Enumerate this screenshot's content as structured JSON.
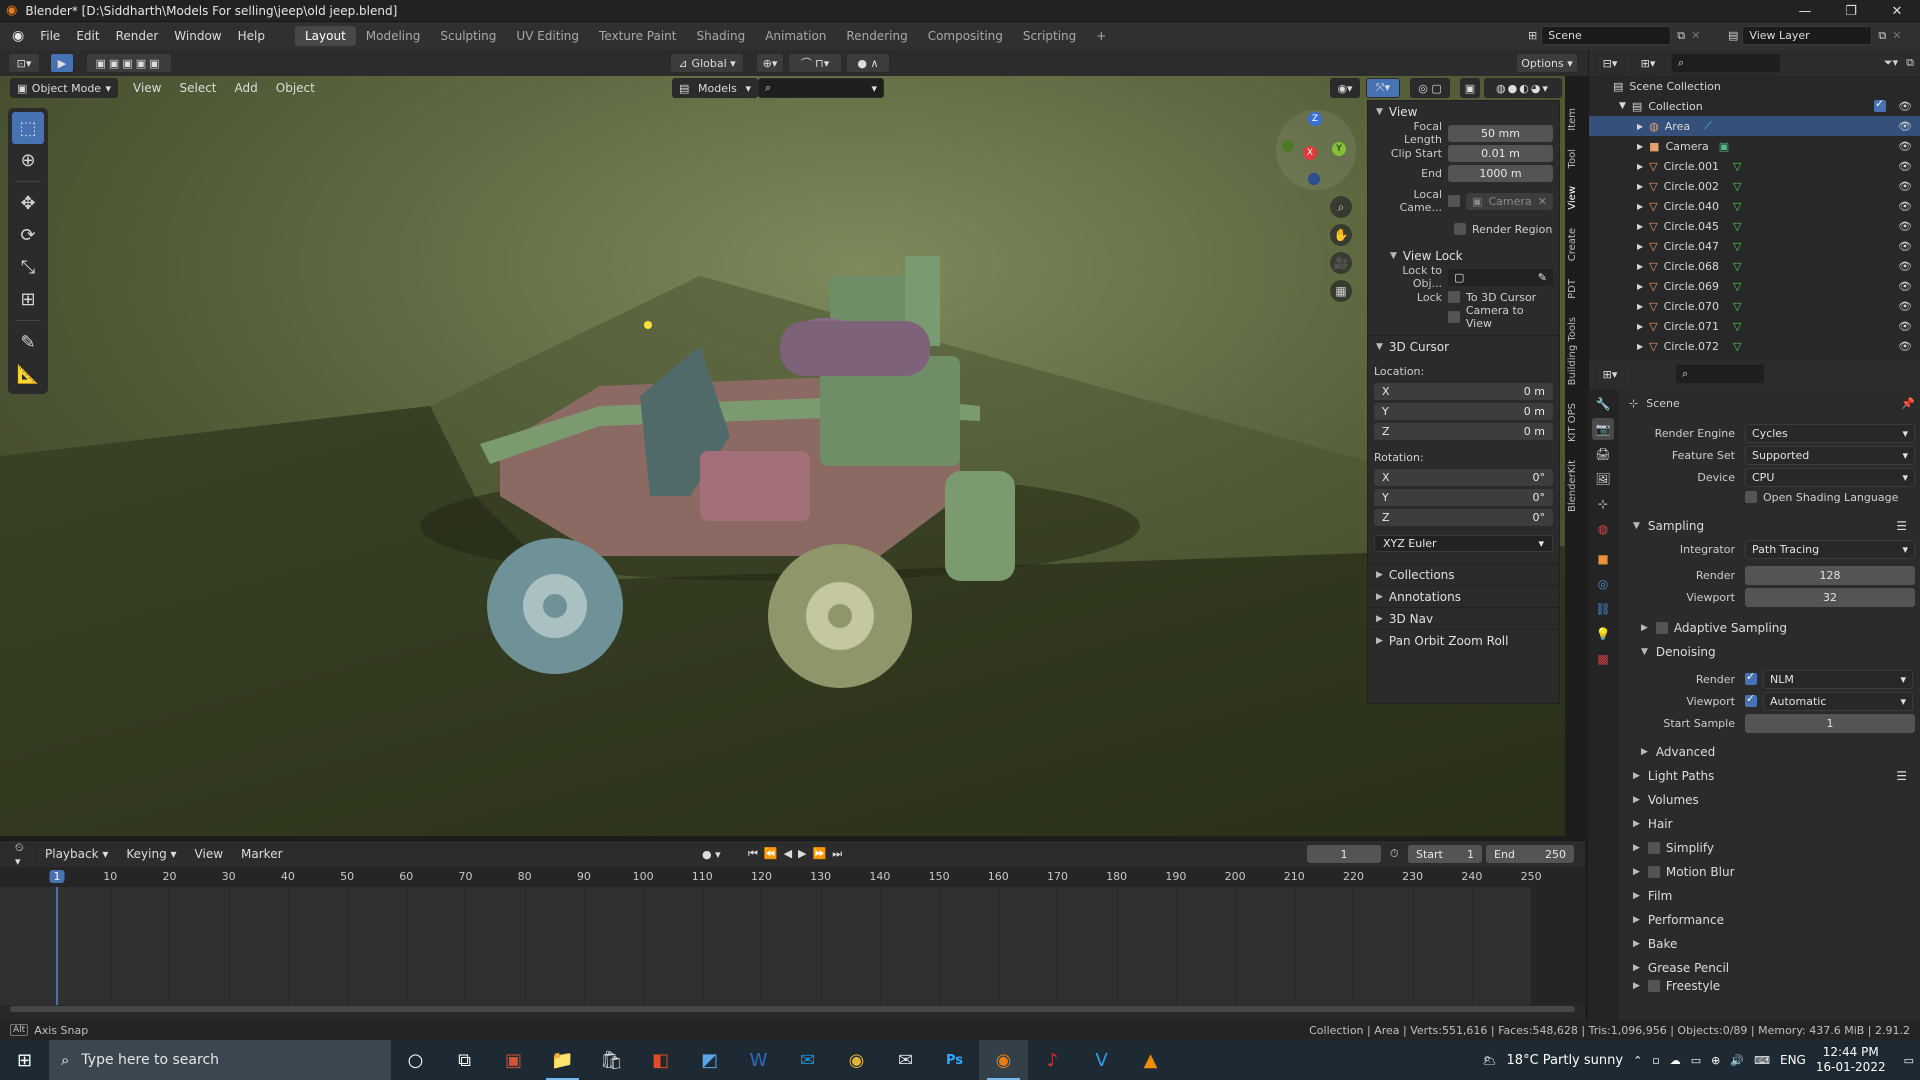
{
  "title": "Blender* [D:\\Siddharth\\Models For selling\\jeep\\old jeep.blend]",
  "menus": [
    "File",
    "Edit",
    "Render",
    "Window",
    "Help"
  ],
  "workspaces": [
    "Layout",
    "Modeling",
    "Sculpting",
    "UV Editing",
    "Texture Paint",
    "Shading",
    "Animation",
    "Rendering",
    "Compositing",
    "Scripting",
    "+"
  ],
  "active_workspace": "Layout",
  "scene_label": "Scene",
  "view_layer_label": "View Layer",
  "header": {
    "transform_orientation": "Global",
    "options": "Options",
    "mode": "Object Mode",
    "view": "View",
    "select": "Select",
    "add": "Add",
    "object": "Object",
    "collection_filter": "Models"
  },
  "npanel": {
    "view_title": "View",
    "focal_length_label": "Focal Length",
    "focal_length": "50 mm",
    "clip_start_label": "Clip Start",
    "clip_start": "0.01 m",
    "end_label": "End",
    "clip_end": "1000 m",
    "local_camera_label": "Local Came...",
    "local_camera": "Camera",
    "render_region": "Render Region",
    "view_lock_title": "View Lock",
    "lock_to_obj_label": "Lock to Obj...",
    "lock_label": "Lock",
    "to_3d_cursor": "To 3D Cursor",
    "camera_to_view": "Camera to View",
    "cursor_title": "3D Cursor",
    "location_label": "Location:",
    "loc": [
      {
        "axis": "X",
        "value": "0 m"
      },
      {
        "axis": "Y",
        "value": "0 m"
      },
      {
        "axis": "Z",
        "value": "0 m"
      }
    ],
    "rotation_label": "Rotation:",
    "rot": [
      {
        "axis": "X",
        "value": "0°"
      },
      {
        "axis": "Y",
        "value": "0°"
      },
      {
        "axis": "Z",
        "value": "0°"
      }
    ],
    "rotation_mode": "XYZ Euler",
    "collapsed": [
      "Collections",
      "Annotations",
      "3D Nav",
      "Pan Orbit Zoom Roll"
    ]
  },
  "vtabs": [
    "Item",
    "Tool",
    "View",
    "Create",
    "PDT",
    "Building Tools",
    "KIT OPS",
    "BlenderKit"
  ],
  "outliner": {
    "root": "Scene Collection",
    "collection": "Collection",
    "items": [
      "Area",
      "Camera",
      "Circle.001",
      "Circle.002",
      "Circle.040",
      "Circle.045",
      "Circle.047",
      "Circle.068",
      "Circle.069",
      "Circle.070",
      "Circle.071",
      "Circle.072"
    ]
  },
  "properties": {
    "context": "Scene",
    "render_engine_label": "Render Engine",
    "render_engine": "Cycles",
    "feature_set_label": "Feature Set",
    "feature_set": "Supported",
    "device_label": "Device",
    "device": "CPU",
    "osl": "Open Shading Language",
    "sampling": "Sampling",
    "integrator_label": "Integrator",
    "integrator": "Path Tracing",
    "render_label": "Render",
    "render_samples": "128",
    "viewport_label": "Viewport",
    "viewport_samples": "32",
    "adaptive": "Adaptive Sampling",
    "denoising": "Denoising",
    "den_render_label": "Render",
    "den_render": "NLM",
    "den_viewport_label": "Viewport",
    "den_viewport": "Automatic",
    "start_sample_label": "Start Sample",
    "start_sample": "1",
    "advanced": "Advanced",
    "sections": [
      "Light Paths",
      "Volumes",
      "Hair",
      "Simplify",
      "Motion Blur",
      "Film",
      "Performance",
      "Bake",
      "Grease Pencil",
      "Freestyle"
    ]
  },
  "timeline": {
    "playback": "Playback",
    "keying": "Keying",
    "view": "View",
    "marker": "Marker",
    "current_frame": "1",
    "start_label": "Start",
    "start": "1",
    "end_label": "End",
    "end": "250",
    "ticks": [
      "1",
      "10",
      "20",
      "30",
      "40",
      "50",
      "60",
      "70",
      "80",
      "90",
      "100",
      "110",
      "120",
      "130",
      "140",
      "150",
      "160",
      "170",
      "180",
      "190",
      "200",
      "210",
      "220",
      "230",
      "240",
      "250"
    ]
  },
  "status": {
    "left": "Axis Snap",
    "right": "Collection | Area | Verts:551,616 | Faces:548,628 | Tris:1,096,956 | Objects:0/89 | Memory: 437.6 MiB | 2.91.2"
  },
  "taskbar": {
    "search_placeholder": "Type here to search",
    "weather": "18°C  Partly sunny",
    "lang": "ENG",
    "time": "12:44 PM",
    "date": "16-01-2022"
  }
}
